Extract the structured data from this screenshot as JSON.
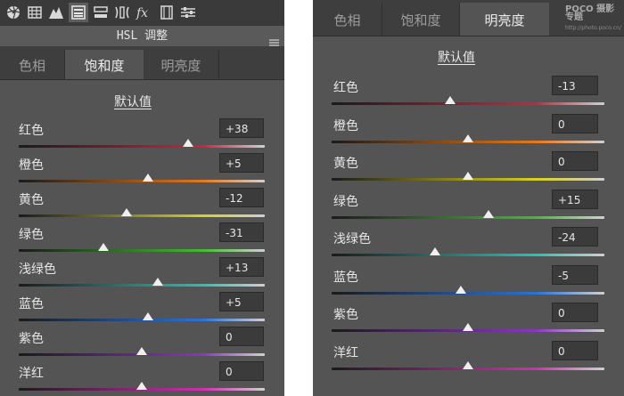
{
  "left": {
    "title": "HSL 调整",
    "tools": [
      "lens-aperture-icon",
      "grid-icon",
      "mountains-icon",
      "hsl-panel-icon",
      "split-tone-icon",
      "lens-corrections-icon",
      "fx-icon",
      "camera-calibration-icon",
      "presets-sliders-icon"
    ],
    "tabs": [
      "色相",
      "饱和度",
      "明亮度"
    ],
    "active_tab": 1,
    "default_label": "默认值",
    "sliders": [
      {
        "label": "红色",
        "value": "+38",
        "level": 38
      },
      {
        "label": "橙色",
        "value": "+5",
        "level": 5
      },
      {
        "label": "黄色",
        "value": "-12",
        "level": -12
      },
      {
        "label": "绿色",
        "value": "-31",
        "level": -31
      },
      {
        "label": "浅绿色",
        "value": "+13",
        "level": 13
      },
      {
        "label": "蓝色",
        "value": "+5",
        "level": 5
      },
      {
        "label": "紫色",
        "value": "0",
        "level": 0
      },
      {
        "label": "洋红",
        "value": "0",
        "level": 0
      }
    ]
  },
  "right": {
    "tabs": [
      "色相",
      "饱和度",
      "明亮度"
    ],
    "active_tab": 2,
    "watermark": {
      "brand": "POCO 摄影专题",
      "url": "http://photo.poco.cn/"
    },
    "default_label": "默认值",
    "sliders": [
      {
        "label": "红色",
        "value": "-13",
        "level": -13
      },
      {
        "label": "橙色",
        "value": "0",
        "level": 0
      },
      {
        "label": "黄色",
        "value": "0",
        "level": 0
      },
      {
        "label": "绿色",
        "value": "+15",
        "level": 15
      },
      {
        "label": "浅绿色",
        "value": "-24",
        "level": -24
      },
      {
        "label": "蓝色",
        "value": "-5",
        "level": -5
      },
      {
        "label": "紫色",
        "value": "0",
        "level": 0
      },
      {
        "label": "洋红",
        "value": "0",
        "level": 0
      }
    ]
  },
  "colors": {
    "红色": "#d0223f",
    "橙色": "#e8771a",
    "黄色": "#d9d21c",
    "绿色": "#3fbe2d",
    "浅绿色": "#23c4b4",
    "蓝色": "#2a72d8",
    "紫色": "#8c35c6",
    "洋红": "#d42cb2"
  }
}
